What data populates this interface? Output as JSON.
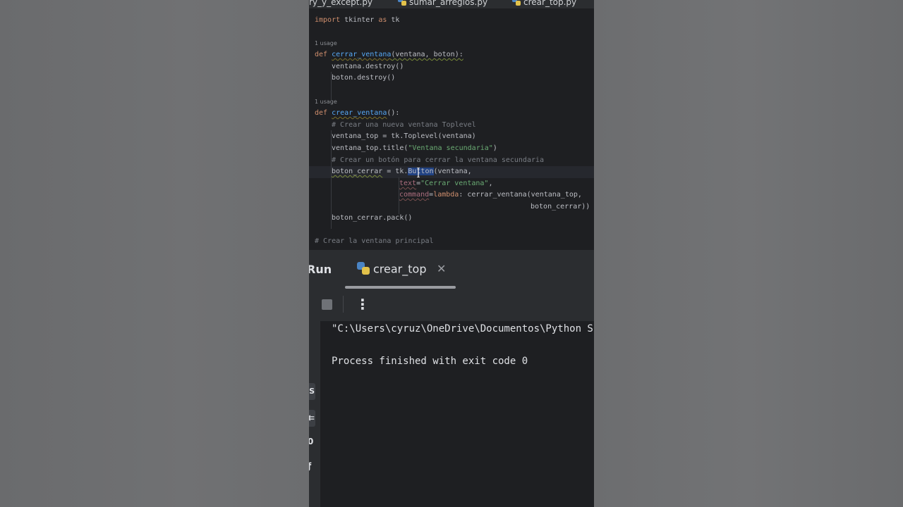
{
  "editor_tabs": [
    {
      "label": "ry_y_except.py"
    },
    {
      "label": "sumar_arreglos.py"
    },
    {
      "label": "crear_top.py"
    }
  ],
  "code": {
    "l1_kw": "import",
    "l1_rest": " tkinter ",
    "l1_as": "as",
    "l1_alias": " tk",
    "hint1": "1 usage",
    "l3_def": "def",
    "l3_fn": "cerrar_ventana",
    "l3_params": "(ventana, boton):",
    "l4": "ventana.destroy()",
    "l5": "boton.destroy()",
    "hint2": "1 usage",
    "l7_def": "def",
    "l7_fn": "crear_ventana",
    "l7_params": "():",
    "l8": "# Crear una nueva ventana Toplevel",
    "l9": "ventana_top = tk.Toplevel(ventana)",
    "l10_a": "ventana_top.title(",
    "l10_str": "\"Ventana secundaria\"",
    "l10_b": ")",
    "l11": "# Crear un botón para cerrar la ventana secundaria",
    "l12_var": "boton_cerrar",
    "l12_a": " = tk.",
    "l12_sel": "Button",
    "l12_b": "(ventana,",
    "l13_kw": "text",
    "l13_eq": "=",
    "l13_str": "\"Cerrar ventana\"",
    "l13_comma": ",",
    "l14_kw": "command",
    "l14_eq": "=",
    "l14_lambda": "lambda",
    "l14_rest": ": cerrar_ventana(ventana_top,",
    "l15": "boton_cerrar))",
    "l16": "boton_cerrar.pack()",
    "l18": "# Crear la ventana principal"
  },
  "run_panel": {
    "title": "Run",
    "tab_label": "crear_top",
    "close_glyph": "✕",
    "more_glyph": "⋮"
  },
  "console": {
    "line1": "\"C:\\Users\\cyruz\\OneDrive\\Documentos\\Python Sc",
    "line2": "Process finished with exit code 0"
  },
  "side_icons": [
    {
      "glyph": "S"
    },
    {
      "glyph": "⇇"
    },
    {
      "glyph": "0"
    },
    {
      "glyph": "ƒ"
    }
  ]
}
